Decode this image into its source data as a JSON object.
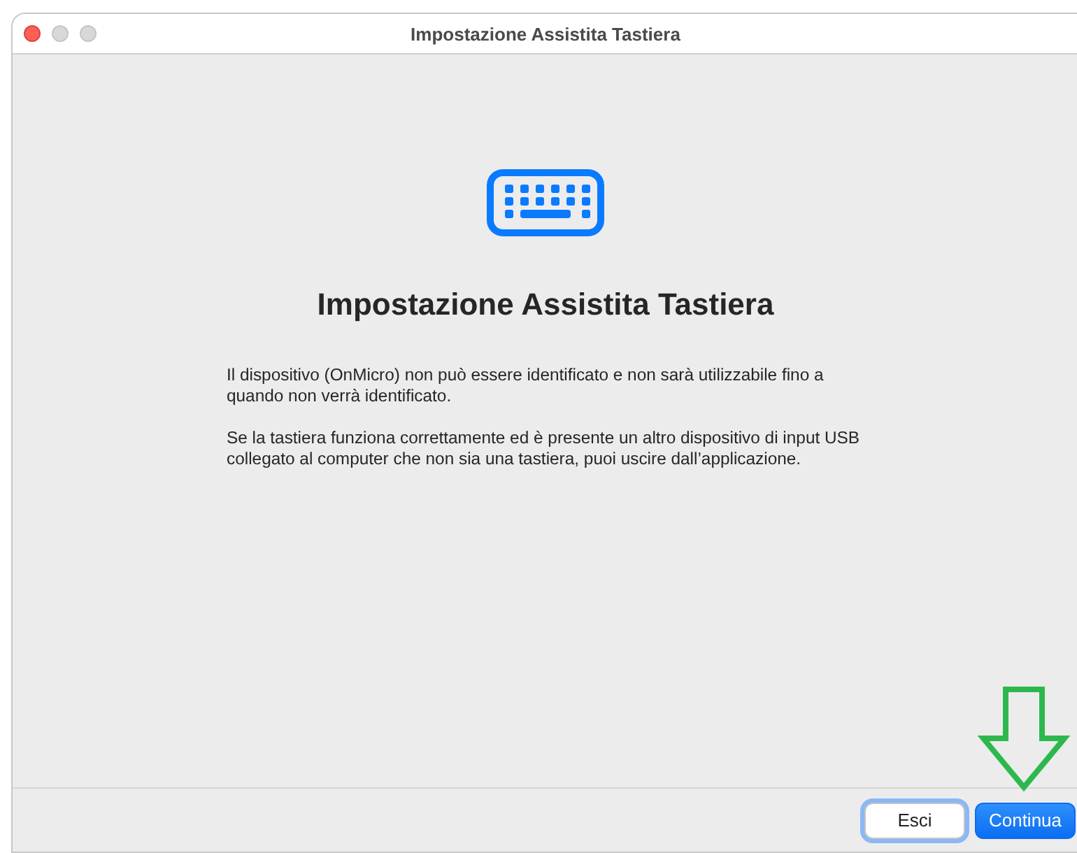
{
  "window": {
    "title": "Impostazione Assistita Tastiera"
  },
  "heading": "Impostazione Assistita Tastiera",
  "paragraphs": [
    "Il dispositivo (OnMicro) non può essere identificato e non sarà utilizzabile fino a quando non verrà identificato.",
    "Se la tastiera funziona correttamente ed è presente un altro dispositivo di input USB collegato al computer che non sia una tastiera, puoi uscire dall’applicazione."
  ],
  "buttons": [
    {
      "label": "Esci",
      "kind": "secondary",
      "focused": true
    },
    {
      "label": "Continua",
      "kind": "primary",
      "focused": false
    }
  ]
}
